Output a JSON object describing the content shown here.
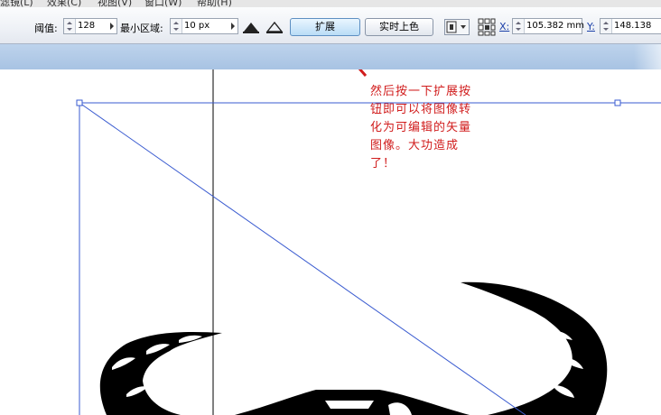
{
  "menubar": {
    "items": [
      "滤镜(L)",
      "效果(C)",
      "视图(V)",
      "窗口(W)",
      "帮助(H)"
    ]
  },
  "toolbar": {
    "threshold_label": "阈值:",
    "threshold_value": "128",
    "min_area_label": "最小区域:",
    "min_area_value": "10 px",
    "expand_button": "扩展",
    "live_paint_button": "实时上色",
    "x_label": "X:",
    "x_value": "105.382 mm",
    "y_label": "Y:",
    "y_value": "148.138"
  },
  "annotation": {
    "text": "然后按一下扩展按钮即可以将图像转化为可编辑的矢量图像。大功造成了！",
    "color": "#d11d1d"
  },
  "colors": {
    "accent_band": "#b3cbe8",
    "selection": "#3a5bd0",
    "artwork": "#000000"
  }
}
